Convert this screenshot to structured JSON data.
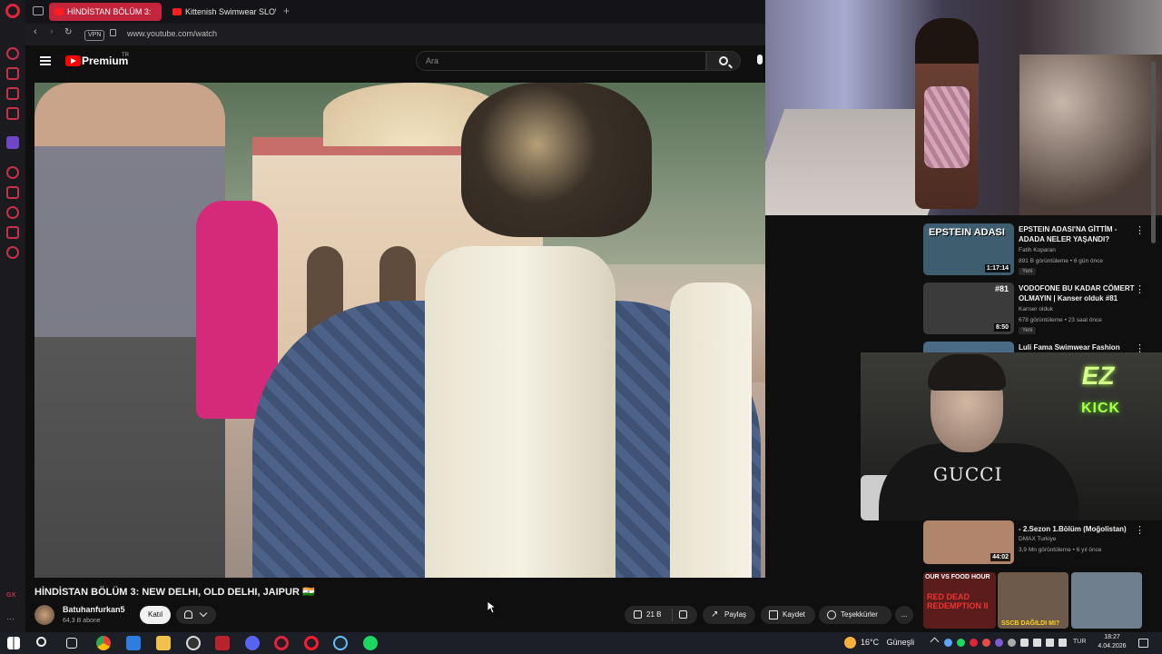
{
  "browser": {
    "tabs": [
      {
        "label": "HİNDİSTAN BÖLÜM 3:",
        "active": true
      },
      {
        "label": "Kittenish Swimwear SLOW",
        "active": false
      }
    ],
    "new_tab_label": "+",
    "vpn_label": "VPN",
    "url": "www.youtube.com/watch"
  },
  "youtube": {
    "logo_text": "Premium",
    "logo_sup": "TR",
    "search_placeholder": "Ara",
    "video": {
      "title": "HİNDİSTAN BÖLÜM 3: NEW DELHI, OLD DELHI, JAIPUR 🇮🇳",
      "channel": "Batuhanfurkan5",
      "subscribers": "64,3 B abone",
      "join_label": "Katıl",
      "likes": "21 B",
      "share_label": "Paylaş",
      "save_label": "Kaydet",
      "thanks_label": "Teşekkürler",
      "more_label": "..."
    },
    "recommendations": [
      {
        "title": "EPSTEIN ADASI'NA GİTTİM - ADADA NELER YAŞANDI?",
        "channel": "Fatih Koparan",
        "meta": "891 B görüntüleme • 6 gün önce",
        "badge": "Yeni",
        "duration": "1:17:14",
        "thumb_text": "EPSTEIN ADASI",
        "thumb_color": "#3e5d6f"
      },
      {
        "title": "VODOFONE BU KADAR CÖMERT OLMAYIN | Kanser olduk #81",
        "channel": "Kanser olduk",
        "meta": "678 görüntüleme • 23 saat önce",
        "badge": "Yeni",
        "duration": "8:50",
        "thumb_text": "#81",
        "thumb_color": "#3b3b3b"
      },
      {
        "title": "Luli Fama Swimwear Fashion",
        "channel": "",
        "meta": "",
        "badge": "",
        "duration": "",
        "thumb_text": "",
        "thumb_color": "#4a6b86"
      },
      {
        "title": "- 2.Sezon 1.Bölüm (Moğolistan)",
        "channel": "DMAX Turkiye",
        "meta": "3,9 Mn görüntüleme • 6 yıl önce",
        "badge": "",
        "duration": "44:02",
        "thumb_text": "",
        "thumb_color": "#b0856b"
      }
    ],
    "bottom_thumbs": [
      {
        "text": "OUR VS FOOD HOUR",
        "sub": "RED DEAD REDEMPTION II",
        "color": "#5a1d1b"
      },
      {
        "text": "SSCB DAĞILDI MI?",
        "sub": "",
        "color": "#6e5a4a"
      },
      {
        "text": "",
        "sub": "",
        "color": "#6f7f8e"
      }
    ]
  },
  "webcam_overlay": {
    "logo_line1": "EZ",
    "logo_line2": "KICK",
    "shirt_text": "GUCCI"
  },
  "taskbar": {
    "temperature": "16°C",
    "weather": "Güneşli",
    "language": "TUR",
    "time": "18:27",
    "date": "4.04.2026",
    "apps": [
      "windows-icon",
      "search-icon",
      "task-view-icon",
      "chrome-icon",
      "edge-icon",
      "explorer-icon",
      "obs-icon",
      "media-icon",
      "discord-icon",
      "opera-gx-icon",
      "opera-icon",
      "steam-icon",
      "spotify-icon"
    ]
  },
  "colors": {
    "accent_red": "#c4243c",
    "youtube_red": "#ff0000",
    "kick_green": "#a8ff4a"
  }
}
